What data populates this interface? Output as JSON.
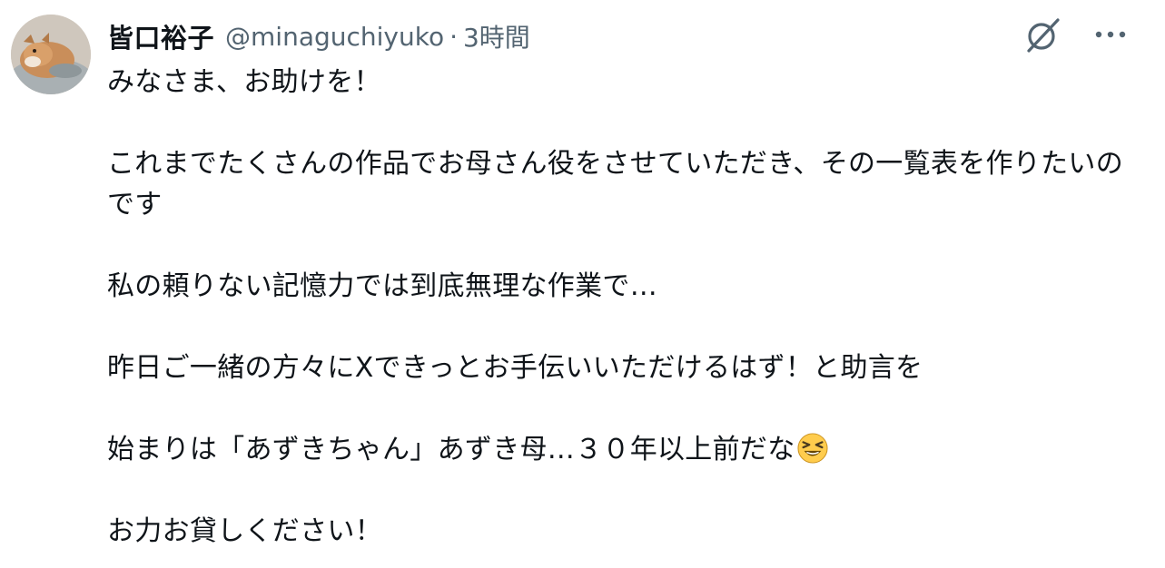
{
  "tweet": {
    "author": {
      "display_name": "皆口裕子",
      "handle": "@minaguchiyuko",
      "avatar_icon": "dog-avatar-icon"
    },
    "separator": "·",
    "timestamp": "3時間",
    "actions": {
      "grok_icon": "grok-icon",
      "more_icon": "more-icon"
    },
    "paragraphs": [
      "みなさま、お助けを！",
      "これまでたくさんの作品でお母さん役をさせていただき、その一覧表を作りたいのです",
      "私の頼りない記憶力では到底無理な作業で…",
      "昨日ご一緒の方々にXできっとお手伝いいただけるはず！と助言を",
      "始まりは「あずきちゃん」あずき母…３０年以上前だな",
      "お力お貸しください！"
    ],
    "emoji": "laughing-squint-face"
  }
}
